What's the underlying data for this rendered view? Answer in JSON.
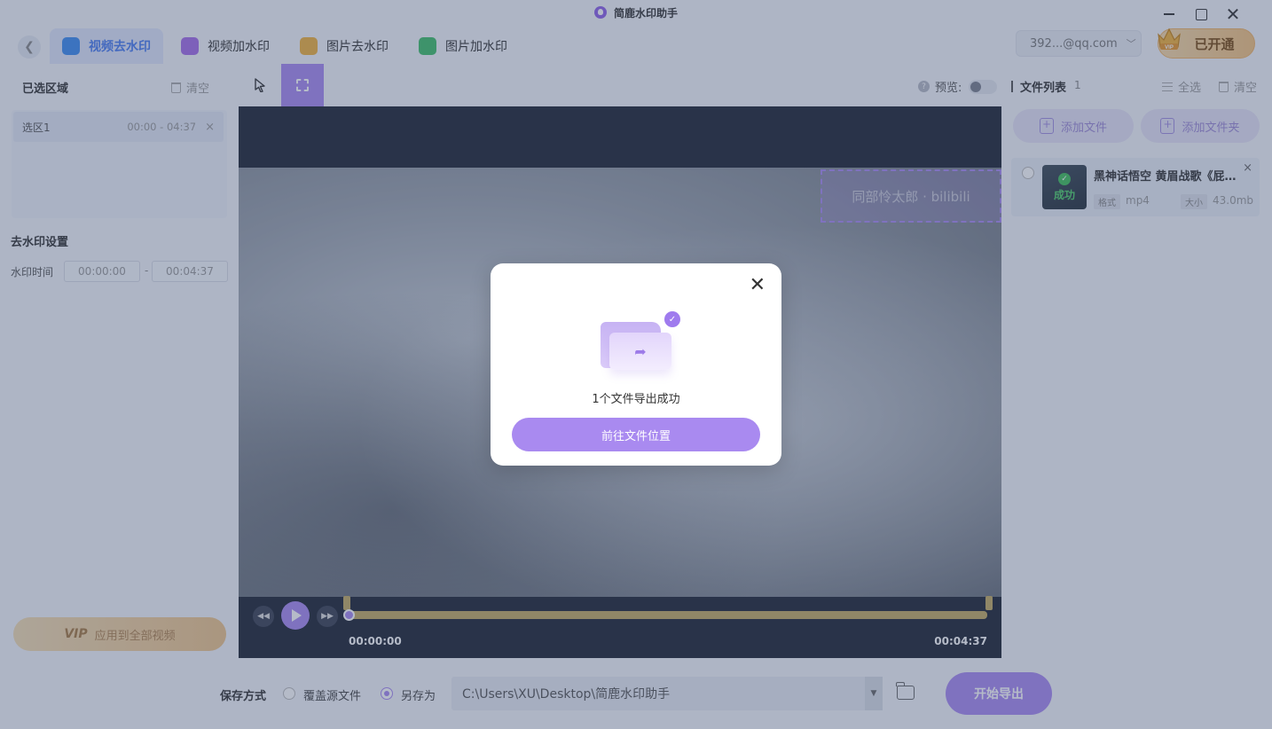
{
  "window": {
    "title": "简鹿水印助手",
    "close_glyph": "✕"
  },
  "nav": {
    "back_glyph": "❮",
    "tabs": [
      {
        "label": "视频去水印",
        "active": true,
        "color": "#3d8bf0"
      },
      {
        "label": "视频加水印",
        "active": false,
        "color": "#a56de8"
      },
      {
        "label": "图片去水印",
        "active": false,
        "color": "#f0b23d"
      },
      {
        "label": "图片加水印",
        "active": false,
        "color": "#3fbf6a"
      }
    ],
    "account": "392...@qq.com",
    "account_chevron": "﹀",
    "vip_label": "已开通",
    "vip_badge": "VIP"
  },
  "left_panel": {
    "selected_title": "已选区域",
    "clear_label": "清空",
    "selection": {
      "name": "选区1",
      "time": "00:00 - 04:37",
      "remove": "×"
    },
    "settings_title": "去水印设置",
    "watermark_time_label": "水印时间",
    "time_start": "00:00:00",
    "time_separator": "-",
    "time_end": "00:04:37",
    "apply_vip": "VIP",
    "apply_label": "应用到全部视频"
  },
  "toolbar": {
    "preview_label": "预览:",
    "help_glyph": "?",
    "preview_on": false
  },
  "player": {
    "watermark_text": "同部怜太郎 · bilibili",
    "rewind_glyph": "◀◀",
    "forward_glyph": "▶▶",
    "time_current": "00:00:00",
    "time_total": "00:04:37",
    "progress": 0
  },
  "right_panel": {
    "title": "文件列表",
    "count": "1",
    "select_all": "全选",
    "clear": "清空",
    "add_file": "添加文件",
    "add_folder": "添加文件夹",
    "file": {
      "name": "黑神话悟空 黄眉战歌《屁》...",
      "status": "成功",
      "status_glyph": "✓",
      "remove": "×",
      "format_label": "格式",
      "format": "mp4",
      "size_label": "大小",
      "size": "43.0mb"
    }
  },
  "bottom": {
    "save_mode_label": "保存方式",
    "overwrite_label": "覆盖源文件",
    "save_as_label": "另存为",
    "save_as_selected": true,
    "path": "C:\\Users\\XU\\Desktop\\简鹿水印助手",
    "path_arrow": "▼",
    "export_label": "开始导出"
  },
  "modal": {
    "close_glyph": "✕",
    "message": "1个文件导出成功",
    "button": "前往文件位置",
    "check_glyph": "✓",
    "arrow_glyph": "➦"
  },
  "colors": {
    "accent": "#a98af0",
    "active_tab": "#4a7cf0",
    "success": "#3fbf5a",
    "vip_gold": "#f4c27e"
  }
}
